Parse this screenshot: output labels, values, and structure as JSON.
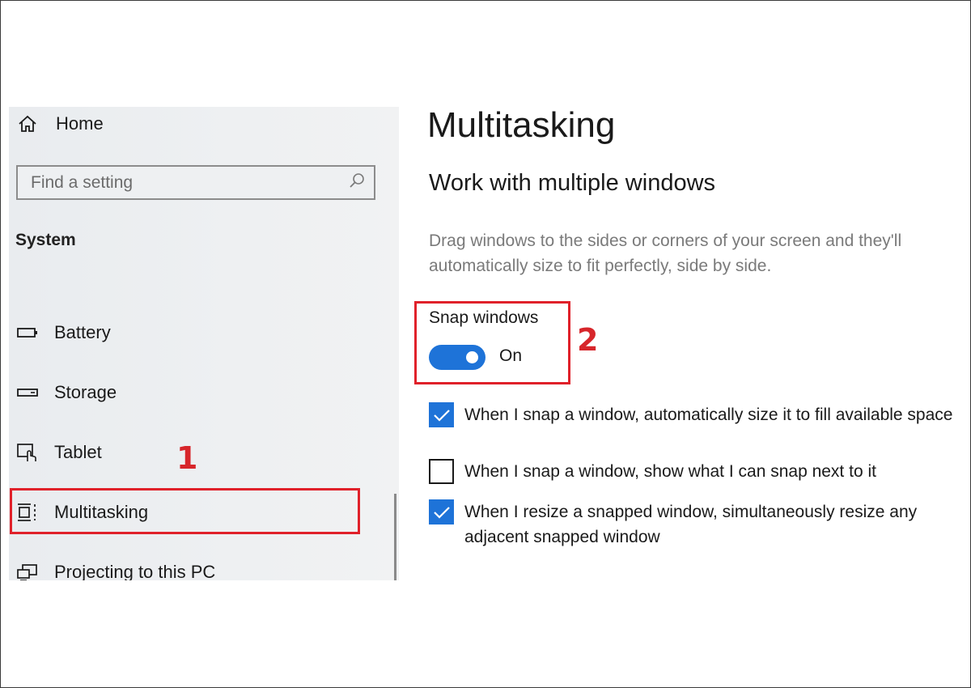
{
  "sidebar": {
    "home_label": "Home",
    "search_placeholder": "Find a setting",
    "section_title": "System",
    "items": [
      {
        "label": "Battery",
        "icon": "battery-icon"
      },
      {
        "label": "Storage",
        "icon": "storage-icon"
      },
      {
        "label": "Tablet",
        "icon": "tablet-icon"
      },
      {
        "label": "Multitasking",
        "icon": "multitasking-icon"
      },
      {
        "label": "Projecting to this PC",
        "icon": "projecting-icon"
      }
    ]
  },
  "main": {
    "title": "Multitasking",
    "subtitle": "Work with multiple windows",
    "description": "Drag windows to the sides or corners of your screen and they'll automatically size to fit perfectly, side by side.",
    "snap": {
      "label": "Snap windows",
      "state_text": "On",
      "enabled": true
    },
    "options": [
      {
        "text": "When I snap a window, automatically size it to fill available space",
        "checked": true
      },
      {
        "text": "When I snap a window, show what I can snap next to it",
        "checked": false
      },
      {
        "text": "When I resize a snapped window, simultaneously resize any adjacent snapped window",
        "checked": true
      }
    ]
  },
  "annotations": {
    "step_1": "1",
    "step_2": "2",
    "highlight_color": "#e0212a"
  },
  "colors": {
    "accent": "#1e73d8",
    "sidebar_bg": "#eef0f2",
    "description_text": "#7a7a7a"
  }
}
